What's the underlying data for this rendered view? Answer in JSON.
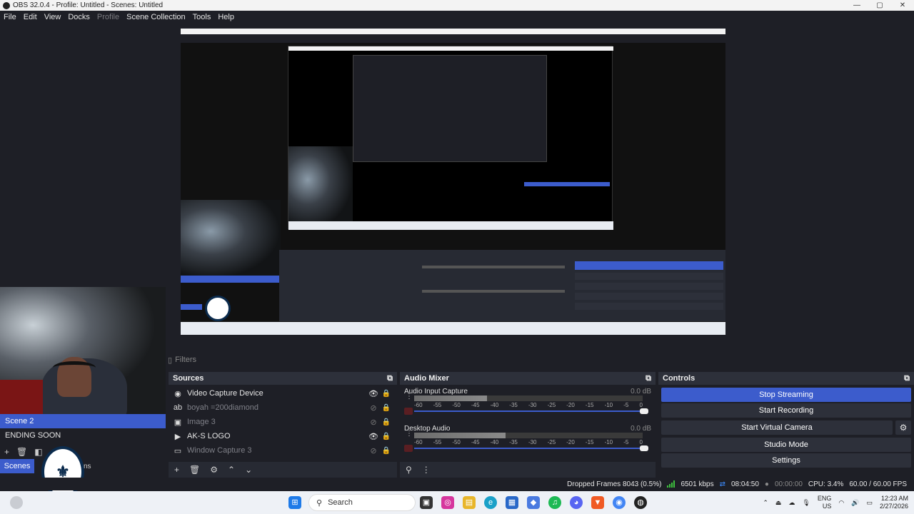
{
  "window": {
    "title": "OBS 32.0.4 - Profile: Untitled - Scenes: Untitled",
    "controls": [
      "—",
      "▢",
      "✕"
    ]
  },
  "menu": [
    "File",
    "Edit",
    "View",
    "Docks",
    "Profile",
    "Scene Collection",
    "Tools",
    "Help"
  ],
  "filters_label": "Filters",
  "scenes": {
    "items": [
      "Scene 2",
      "ENDING SOON"
    ],
    "tab_label": "Scenes",
    "tab_label_partial": "ns"
  },
  "sources": {
    "title": "Sources",
    "items": [
      {
        "name": "Video Capture Device",
        "icon": "camera-icon",
        "visible": true
      },
      {
        "name": "boyah =200diamond",
        "icon": "text-icon",
        "visible": false
      },
      {
        "name": "Image 3",
        "icon": "image-icon",
        "visible": false
      },
      {
        "name": "AK-S LOGO",
        "icon": "play-icon",
        "visible": true
      },
      {
        "name": "Window Capture 3",
        "icon": "window-icon",
        "visible": false
      }
    ]
  },
  "mixer": {
    "title": "Audio Mixer",
    "scale": [
      "-60",
      "-55",
      "-50",
      "-45",
      "-40",
      "-35",
      "-30",
      "-25",
      "-20",
      "-15",
      "-10",
      "-5",
      "0"
    ],
    "channels": [
      {
        "name": "Audio Input Capture",
        "db": "0.0 dB",
        "level": 0.32,
        "volume": 1.0
      },
      {
        "name": "Desktop Audio",
        "db": "0.0 dB",
        "level": 0.4,
        "volume": 1.0
      }
    ]
  },
  "controls": {
    "title": "Controls",
    "stop_streaming": "Stop Streaming",
    "start_recording": "Start Recording",
    "start_virtual_camera": "Start Virtual Camera",
    "studio_mode": "Studio Mode",
    "settings": "Settings"
  },
  "status": {
    "dropped_frames": "Dropped Frames 8043 (0.5%)",
    "bitrate": "6501 kbps",
    "stream_time": "08:04:50",
    "rec_time": "00:00:00",
    "cpu": "CPU: 3.4%",
    "fps": "60.00 / 60.00 FPS"
  },
  "taskbar": {
    "search_placeholder": "Search",
    "lang": "ENG",
    "region": "US",
    "time": "12:23 AM",
    "date": "2/27/2026"
  },
  "colors": {
    "accent": "#3c5ccc",
    "bg": "#1e1f26",
    "dock": "#272a33"
  }
}
